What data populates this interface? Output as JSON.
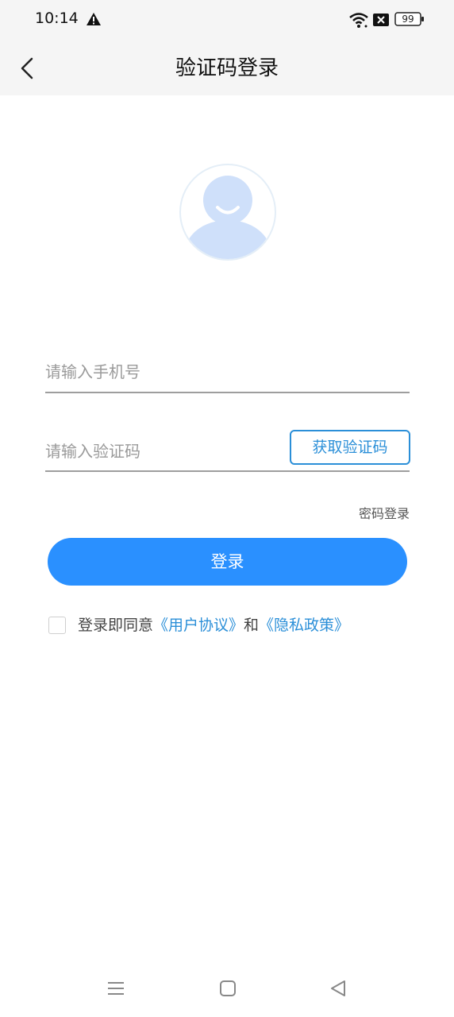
{
  "status_bar": {
    "time": "10:14",
    "battery": "99",
    "icons": [
      "warning-icon",
      "wifi-icon",
      "sim-disabled-icon",
      "battery-icon"
    ]
  },
  "header": {
    "title": "验证码登录",
    "back_icon": "chevron-left-icon"
  },
  "avatar": {
    "icon": "default-user-avatar-icon",
    "colors": {
      "ring": "#e4eef7",
      "fill": "#cfe0fa",
      "smile": "#ffffff"
    }
  },
  "form": {
    "phone": {
      "value": "",
      "placeholder": "请输入手机号"
    },
    "code": {
      "value": "",
      "placeholder": "请输入验证码"
    },
    "get_code_button": "获取验证码",
    "password_login_link": "密码登录",
    "login_button": "登录"
  },
  "agreement": {
    "checked": false,
    "prefix": "登录即同意",
    "user_agreement": "《用户协议》",
    "conjunction": "和",
    "privacy_policy": "《隐私政策》"
  },
  "bottom_nav": {
    "icons": [
      "menu-icon",
      "home-icon",
      "back-triangle-icon"
    ]
  },
  "colors": {
    "accent": "#2a90ff",
    "link": "#2b8fd8",
    "header_bg": "#f5f5f5",
    "divider": "#9e9e9e"
  }
}
